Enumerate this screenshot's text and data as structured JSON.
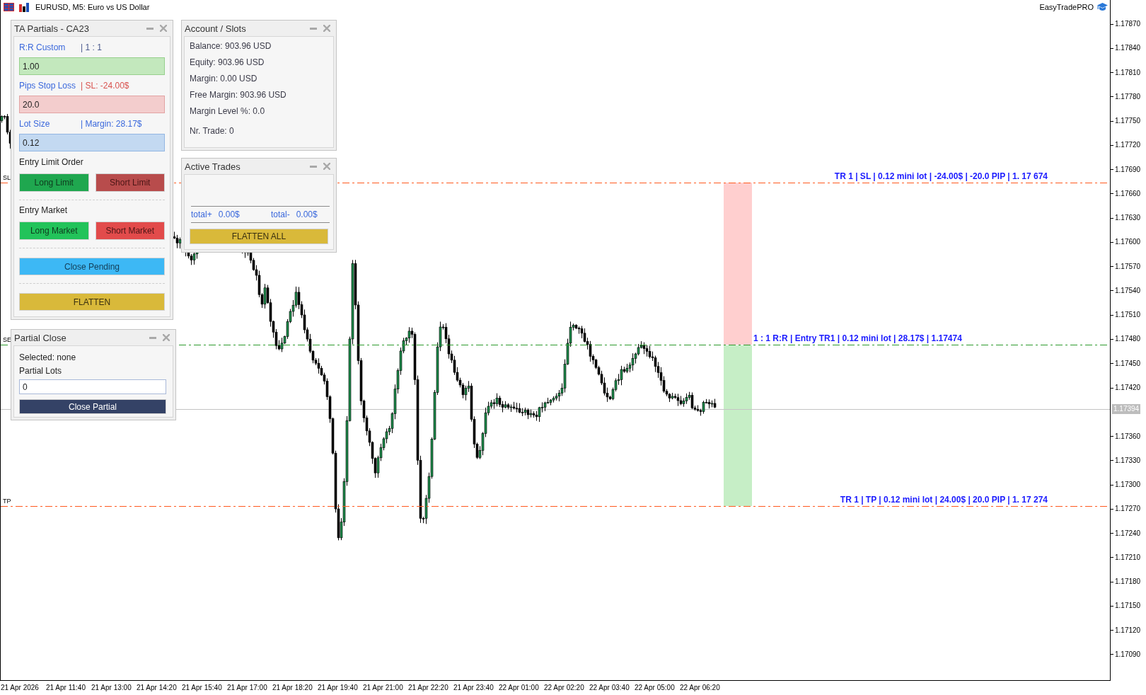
{
  "window": {
    "title": "EURUSD, M5: Euro vs US Dollar",
    "brand": "EasyTradePRO"
  },
  "chart_lines": [
    {
      "kind": "stop_loss",
      "tag": "SL",
      "label": "TR 1 | SL | 0.12 mini lot | -24.00$ | -20.0 PIP | 1. 17 674",
      "color": "#ff5a1f"
    },
    {
      "kind": "entry",
      "tag": "SE",
      "label": "1 : 1 R:R | Entry TR1 | 0.12 mini lot | 28.17$ | 1.17474",
      "color": "#2e9a2e"
    },
    {
      "kind": "take_profit",
      "tag": "TP",
      "label": "TR 1 | TP | 0.12 mini lot | 24.00$ | 20.0 PIP | 1. 17 274",
      "color": "#ff5a1f"
    }
  ],
  "price_axis": {
    "ticks_above": [
      "1.17870",
      "1.17840",
      "1.17810",
      "1.17780",
      "1.17750",
      "1.17720",
      "1.17690",
      "1.17660",
      "1.17630",
      "1.17600",
      "1.17570",
      "1.17540",
      "1.17510",
      "1.17480",
      "1.17450",
      "1.17420"
    ],
    "current_price": "1.17394",
    "ticks_below": [
      "1.17360",
      "1.17330",
      "1.17300",
      "1.17270",
      "1.17240",
      "1.17210",
      "1.17180",
      "1.17150",
      "1.17120",
      "1.17090"
    ]
  },
  "time_axis": {
    "labels": [
      "21 Apr 2026",
      "21 Apr 11:40",
      "21 Apr 13:00",
      "21 Apr 14:20",
      "21 Apr 15:40",
      "21 Apr 17:00",
      "21 Apr 18:20",
      "21 Apr 19:40",
      "21 Apr 21:00",
      "21 Apr 22:20",
      "21 Apr 23:40",
      "22 Apr 01:00",
      "22 Apr 02:20",
      "22 Apr 03:40",
      "22 Apr 05:00",
      "22 Apr 06:20"
    ]
  },
  "ta_partials": {
    "title": "TA Partials - CA23",
    "inputs": [
      {
        "kind": "reward",
        "label": "R:R Custom",
        "info": "| 1 : 1",
        "value": "1.00"
      },
      {
        "kind": "risk",
        "label": "Pips Stop Loss",
        "info": "| SL: -24.00$",
        "value": "20.0"
      },
      {
        "kind": "size",
        "label": "Lot Size",
        "info": "| Margin: 28.17$",
        "value": "0.12"
      }
    ],
    "sections": [
      {
        "heading": "Entry Limit Order",
        "buttons": [
          {
            "kind": "long_limit",
            "label": "Long Limit"
          },
          {
            "kind": "short_limit",
            "label": "Short Limit"
          }
        ]
      },
      {
        "heading": "Entry Market",
        "buttons": [
          {
            "kind": "long_market",
            "label": "Long Market"
          },
          {
            "kind": "short_market",
            "label": "Short Market"
          }
        ]
      },
      {
        "buttons": [
          {
            "kind": "close_pending",
            "label": "Close Pending"
          }
        ]
      },
      {
        "buttons": [
          {
            "kind": "flatten",
            "label": "FLATTEN"
          }
        ]
      }
    ]
  },
  "account": {
    "title": "Account / Slots",
    "lines": [
      "Balance: 903.96 USD",
      "Equity: 903.96 USD",
      "Margin: 0.00 USD",
      "Free Margin: 903.96 USD",
      "Margin Level %: 0.0"
    ],
    "trades": "Nr. Trade: 0"
  },
  "active_trades": {
    "title": "Active Trades",
    "totals": [
      {
        "label": "total+",
        "value": "0.00$"
      },
      {
        "label": "total-",
        "value": "0.00$"
      }
    ],
    "button": "FLATTEN ALL"
  },
  "partial_close": {
    "title": "Partial Close",
    "selection": "Selected: none",
    "field_label": "Partial Lots",
    "value": "0",
    "button": "Close Partial"
  }
}
